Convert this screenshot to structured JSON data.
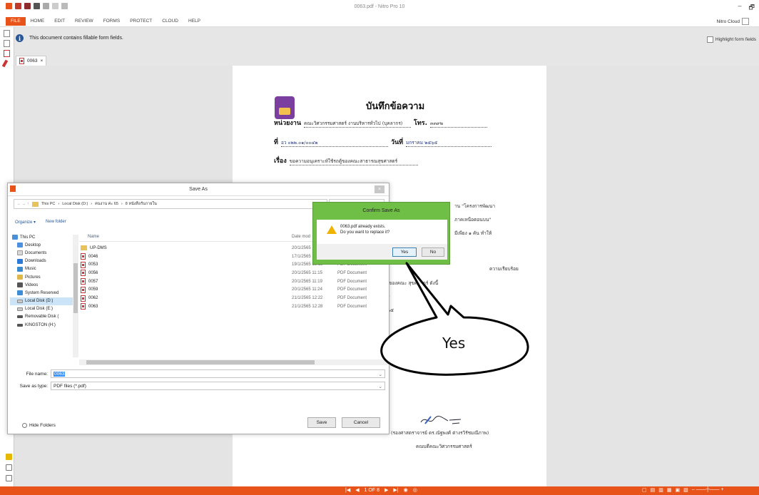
{
  "window": {
    "title": "0063.pdf - Nitro Pro 10",
    "controls": [
      "–",
      "🗗"
    ]
  },
  "ribbon": {
    "tabs": [
      "FILE",
      "HOME",
      "EDIT",
      "REVIEW",
      "FORMS",
      "PROTECT",
      "CLOUD",
      "HELP"
    ],
    "nitro_cloud": "Nitro Cloud"
  },
  "infobar": {
    "message": "This document contains fillable form fields.",
    "highlight_label": "Highlight form fields"
  },
  "doc_tab": {
    "label": "0063",
    "close": "×"
  },
  "memo": {
    "title": "บันทึกข้อความ",
    "dept_label": "หน่วยงาน",
    "dept_value": "คณะวิศวกรรมศาสตร์ งานบริหารทั่วไป (บุคลากร)",
    "tel_label": "โทร.",
    "tel_value": "๓๓๙๒",
    "ref_label": "ที่",
    "ref_value": "อว ๐๒๒.๐๑/๐๐๔๒",
    "date_label": "วันที่",
    "date_value": "มกราคม ๒๕๖๕",
    "subject_label": "เรื่อง",
    "subject_value": "ขอความอนุเคราะห์ใช้รถตู้ของคณะสาธารณสุขศาสตร์",
    "lines": [
      "าน \"โครงการพัฒนา",
      "ภาคเหนือตอนบน\"",
      "มีเพียง ๑ คัน ทำให้",
      "ความเรียบร้อย",
      "ของคณะ      สุขศาสตร์ ดังนี้",
      "ร",
      "๖๕",
      "(รองศาสตราจารย์ ดร.ณัฐพงศ์ ต่างรวิรัชมณีภาพ)",
      "คณบดีคณะวิศวกรรมศาสตร์"
    ]
  },
  "save_as": {
    "title": "Save As",
    "close": "×",
    "breadcrumb": [
      "This PC",
      "Local Disk (D:)",
      "คนงาน ค่ะ 65",
      "8 หนังสือรับภายใน"
    ],
    "search_placeholder": "Sea",
    "nav_arrows": "← →  ↑",
    "refresh": "↻",
    "organize": "Organize ▾",
    "new_folder": "New folder",
    "col_name": "Name",
    "col_date": "Date mod",
    "nav": [
      "This PC",
      "Desktop",
      "Documents",
      "Downloads",
      "Music",
      "Pictures",
      "Videos",
      "System Reserved",
      "Local Disk (D:)",
      "Local Disk (E:)",
      "Removable Disk (",
      "KINGSTON (H:)"
    ],
    "files": [
      {
        "name": "UP-DMS",
        "date": "20/1/2565",
        "type": "",
        "kind": "folder"
      },
      {
        "name": "0046",
        "date": "17/1/2565",
        "type": "",
        "kind": "pdf"
      },
      {
        "name": "0053",
        "date": "19/1/2565 13:18",
        "type": "PDF Document",
        "kind": "pdf"
      },
      {
        "name": "0056",
        "date": "20/1/2565 11:15",
        "type": "PDF Document",
        "kind": "pdf"
      },
      {
        "name": "0057",
        "date": "20/1/2565 11:19",
        "type": "PDF Document",
        "kind": "pdf"
      },
      {
        "name": "0059",
        "date": "20/1/2565 11:24",
        "type": "PDF Document",
        "kind": "pdf"
      },
      {
        "name": "0062",
        "date": "21/1/2565 12:22",
        "type": "PDF Document",
        "kind": "pdf"
      },
      {
        "name": "0063",
        "date": "21/1/2565 12:28",
        "type": "PDF Document",
        "kind": "pdf"
      }
    ],
    "file_name_label": "File name:",
    "file_name_value": "0063",
    "save_type_label": "Save as type:",
    "save_type_value": "PDF files (*.pdf)",
    "hide_folders": "Hide Folders",
    "save_button": "Save",
    "cancel_button": "Cancel"
  },
  "confirm": {
    "title": "Confirm Save As",
    "line1": "0063.pdf already exists.",
    "line2": "Do you want to replace it?",
    "yes": "Yes",
    "no": "No"
  },
  "callout": {
    "text": "Yes"
  },
  "status": {
    "page": "1 OF 8",
    "first": "|◀",
    "prev": "◀",
    "next": "▶",
    "last": "▶|"
  },
  "colors": {
    "accent": "#e8531a",
    "confirm": "#6fbe46"
  }
}
